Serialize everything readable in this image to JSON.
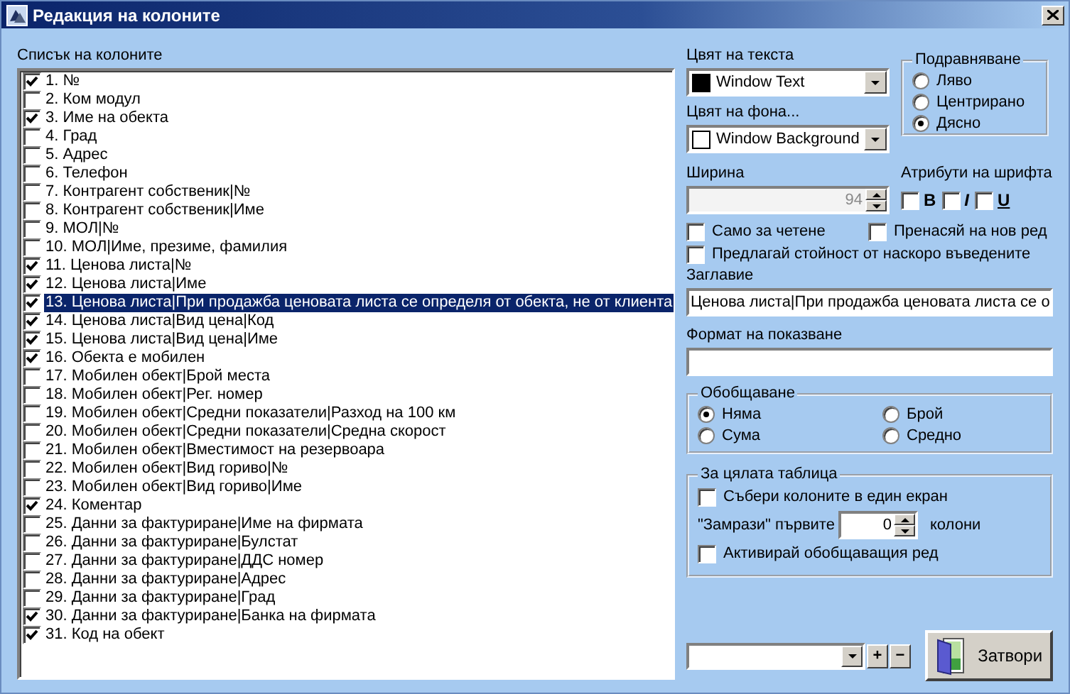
{
  "window": {
    "title": "Редакция на колоните"
  },
  "columns_list": {
    "label": "Списък на колоните",
    "items": [
      {
        "text": "1. №",
        "checked": true,
        "selected": false
      },
      {
        "text": "2. Ком модул",
        "checked": false,
        "selected": false
      },
      {
        "text": "3. Име на обекта",
        "checked": true,
        "selected": false
      },
      {
        "text": "4. Град",
        "checked": false,
        "selected": false
      },
      {
        "text": "5. Адрес",
        "checked": false,
        "selected": false
      },
      {
        "text": "6. Телефон",
        "checked": false,
        "selected": false
      },
      {
        "text": "7. Контрагент собственик|№",
        "checked": false,
        "selected": false
      },
      {
        "text": "8. Контрагент собственик|Име",
        "checked": false,
        "selected": false
      },
      {
        "text": "9. МОЛ|№",
        "checked": false,
        "selected": false
      },
      {
        "text": "10. МОЛ|Име, презиме, фамилия",
        "checked": false,
        "selected": false
      },
      {
        "text": "11. Ценова листа|№",
        "checked": true,
        "selected": false
      },
      {
        "text": "12. Ценова листа|Име",
        "checked": true,
        "selected": false
      },
      {
        "text": "13. Ценова листа|При продажба ценовата листа се определя от обекта, не от клиента",
        "checked": true,
        "selected": true
      },
      {
        "text": "14. Ценова листа|Вид цена|Код",
        "checked": true,
        "selected": false
      },
      {
        "text": "15. Ценова листа|Вид цена|Име",
        "checked": true,
        "selected": false
      },
      {
        "text": "16. Обекта е мобилен",
        "checked": true,
        "selected": false
      },
      {
        "text": "17. Мобилен обект|Брой места",
        "checked": false,
        "selected": false
      },
      {
        "text": "18. Мобилен обект|Рег. номер",
        "checked": false,
        "selected": false
      },
      {
        "text": "19. Мобилен обект|Средни показатели|Разход на 100 км",
        "checked": false,
        "selected": false
      },
      {
        "text": "20. Мобилен обект|Средни показатели|Средна скорост",
        "checked": false,
        "selected": false
      },
      {
        "text": "21. Мобилен обект|Вместимост на резервоара",
        "checked": false,
        "selected": false
      },
      {
        "text": "22. Мобилен обект|Вид гориво|№",
        "checked": false,
        "selected": false
      },
      {
        "text": "23. Мобилен обект|Вид гориво|Име",
        "checked": false,
        "selected": false
      },
      {
        "text": "24. Коментар",
        "checked": true,
        "selected": false
      },
      {
        "text": "25. Данни за фактуриране|Име на фирмата",
        "checked": false,
        "selected": false
      },
      {
        "text": "26. Данни за фактуриране|Булстат",
        "checked": false,
        "selected": false
      },
      {
        "text": "27. Данни за фактуриране|ДДС номер",
        "checked": false,
        "selected": false
      },
      {
        "text": "28. Данни за фактуриране|Адрес",
        "checked": false,
        "selected": false
      },
      {
        "text": "29. Данни за фактуриране|Град",
        "checked": false,
        "selected": false
      },
      {
        "text": "30. Данни за фактуриране|Банка на фирмата",
        "checked": true,
        "selected": false
      },
      {
        "text": "31. Код на обект",
        "checked": true,
        "selected": false
      }
    ]
  },
  "text_color": {
    "label": "Цвят на текста",
    "value": "Window Text",
    "color": "#000000"
  },
  "background_color": {
    "label": "Цвят на фона...",
    "value": "Window Background",
    "color": "#ffffff"
  },
  "alignment": {
    "title": "Подравняване",
    "options": [
      {
        "label": "Ляво",
        "selected": false
      },
      {
        "label": "Центрирано",
        "selected": false
      },
      {
        "label": "Дясно",
        "selected": true
      }
    ]
  },
  "width": {
    "label": "Ширина",
    "value": "94",
    "disabled": true
  },
  "font_attributes": {
    "label": "Атрибути на шрифта",
    "items": [
      {
        "label": "B",
        "kind": "bold",
        "checked": false
      },
      {
        "label": "I",
        "kind": "italic",
        "checked": false
      },
      {
        "label": "U",
        "kind": "underline",
        "checked": false
      }
    ]
  },
  "options": [
    {
      "label": "Само за четене",
      "checked": false
    },
    {
      "label": "Пренасяй на нов ред",
      "checked": false
    },
    {
      "label": "Предлагай стойност от наскоро въведените",
      "checked": false
    }
  ],
  "caption": {
    "label": "Заглавие",
    "value": "Ценова листа|При продажба ценовата листа се о"
  },
  "display_format": {
    "label": "Формат на показване"
  },
  "summary": {
    "title": "Обобщаване",
    "options": [
      {
        "label": "Няма",
        "selected": true
      },
      {
        "label": "Брой",
        "selected": false
      },
      {
        "label": "Сума",
        "selected": false
      },
      {
        "label": "Средно",
        "selected": false
      }
    ]
  },
  "whole_table": {
    "title": "За цялата таблица",
    "fit_columns": {
      "label": "Събери колоните в един екран",
      "checked": false
    },
    "freeze": {
      "prefix": "\"Замрази\" първите",
      "value": "0",
      "suffix": "колони"
    },
    "summary_row": {
      "label": "Активирай обобщаващия ред",
      "checked": false
    }
  },
  "preset": {
    "buttons": [
      "+",
      "−"
    ]
  },
  "close_button": {
    "label": "Затвори"
  }
}
